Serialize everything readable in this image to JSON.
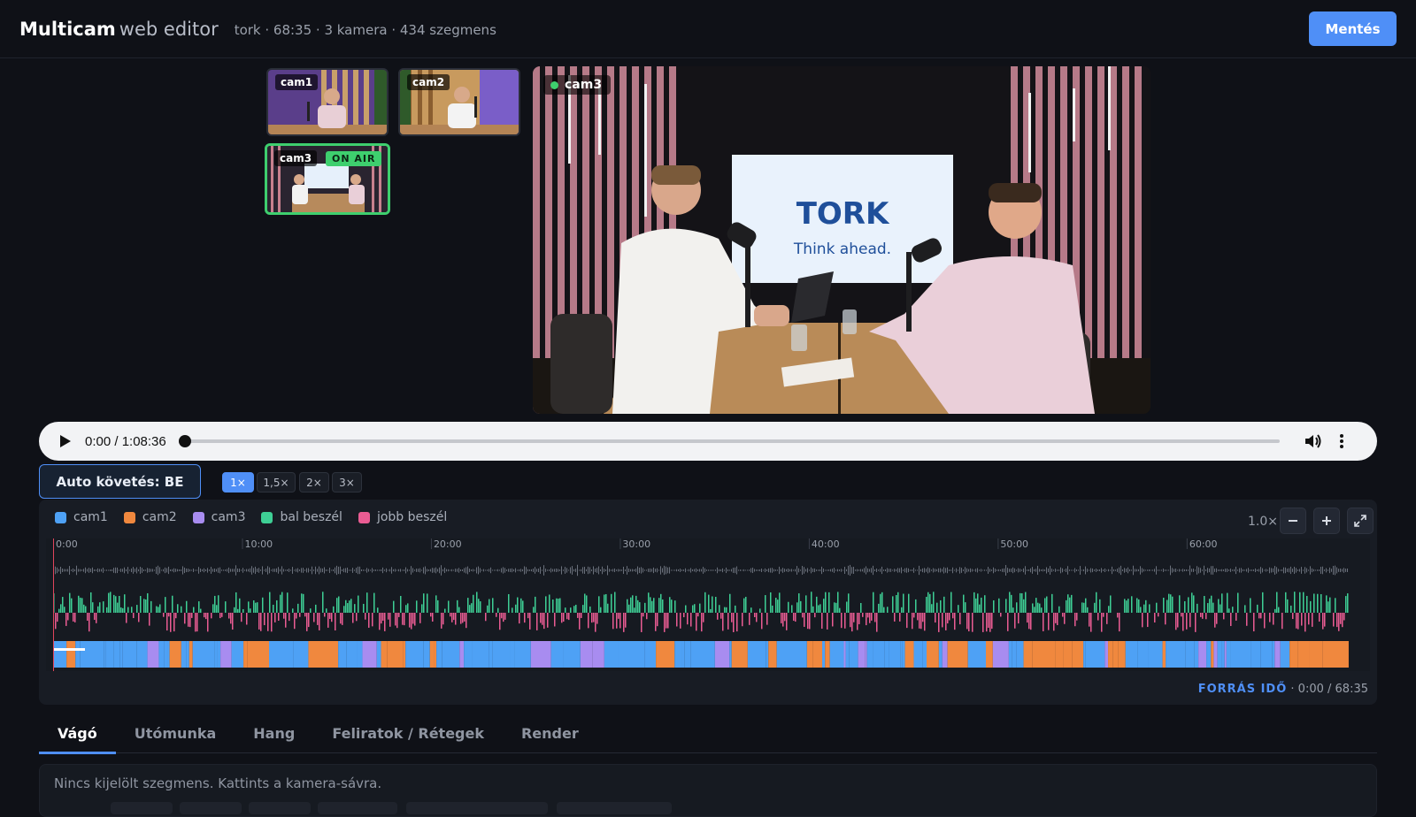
{
  "header": {
    "title_bold": "Multicam",
    "title_light": "web editor",
    "meta": "tork · 68:35 · 3 kamera · 434 szegmens",
    "save_label": "Mentés"
  },
  "cameras": [
    {
      "label": "cam1"
    },
    {
      "label": "cam2"
    },
    {
      "label": "cam3",
      "badge": "ON AIR"
    }
  ],
  "main_view": {
    "cam_label": "cam3",
    "brand_logo": "TORK",
    "brand_slogan": "Think ahead."
  },
  "player": {
    "time": "0:00 / 1:08:36",
    "progress": 0
  },
  "controls": {
    "auto_follow": "Auto követés: BE",
    "speeds": [
      "1×",
      "1,5×",
      "2×",
      "3×"
    ],
    "selected_speed": "1×"
  },
  "timeline": {
    "legend": [
      {
        "label": "cam1",
        "color": "#4ea1f5"
      },
      {
        "label": "cam2",
        "color": "#f0883e"
      },
      {
        "label": "cam3",
        "color": "#a88cf0"
      },
      {
        "label": "bal beszél",
        "color": "#3ecf95"
      },
      {
        "label": "jobb beszél",
        "color": "#ea5c93"
      }
    ],
    "zoom": "1.0×",
    "ticks": [
      "0:00",
      "10:00",
      "20:00",
      "30:00",
      "40:00",
      "50:00",
      "60:00"
    ],
    "source_label": "FORRÁS IDŐ",
    "source_time": "· 0:00 / 68:35"
  },
  "tabs": [
    "Vágó",
    "Utómunka",
    "Hang",
    "Feliratok / Rétegek",
    "Render"
  ],
  "active_tab": "Vágó",
  "status": "Nincs kijelölt szegmens. Kattints a kamera-sávra.",
  "icons": {
    "play": "play-icon",
    "volume": "volume-icon",
    "more": "more-vertical-icon",
    "zoom_out": "minus-icon",
    "zoom_in": "plus-icon",
    "fit": "expand-icon"
  }
}
